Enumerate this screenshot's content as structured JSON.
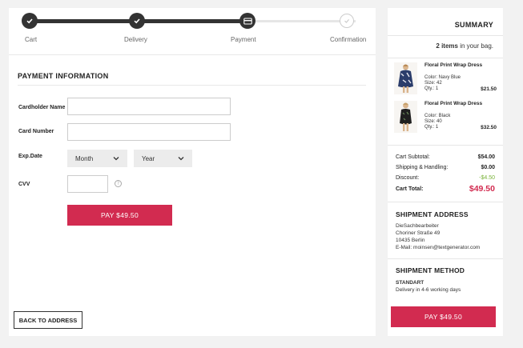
{
  "steps": [
    {
      "label": "Cart",
      "state": "done"
    },
    {
      "label": "Delivery",
      "state": "done"
    },
    {
      "label": "Payment",
      "state": "current"
    },
    {
      "label": "Confirmation",
      "state": "todo"
    }
  ],
  "payment": {
    "title": "PAYMENT INFORMATION",
    "cardholder_label": "Cardholder Name",
    "cardholder_value": "",
    "cardnumber_label": "Card Number",
    "cardnumber_value": "",
    "exp_label": "Exp.Date",
    "month_value": "Month",
    "year_value": "Year",
    "cvv_label": "CVV",
    "cvv_value": "",
    "help_symbol": "?",
    "pay_label": "PAY $49.50"
  },
  "back_label": "BACK TO ADDRESS",
  "summary": {
    "title": "SUMMARY",
    "items_count": "2 items",
    "items_suffix": " in your bag.",
    "products": [
      {
        "name": "Floral Print Wrap Dress",
        "color": "Color: Navy Blue",
        "size": "Size:  42",
        "qty": "Qty.:  1",
        "price": "$21.50"
      },
      {
        "name": "Floral Print Wrap Dress",
        "color": "Color: Black",
        "size": "Size:  40",
        "qty": "Qty.:  1",
        "price": "$32.50"
      }
    ],
    "subtotal_label": "Cart Subtotal:",
    "subtotal_value": "$54.00",
    "shipping_label": "Shipping & Handling:",
    "shipping_value": "$0.00",
    "discount_label": "Discount:",
    "discount_value": "-$4.50",
    "total_label": "Cart Total:",
    "total_value": "$49.50",
    "shipment_address_title": "SHIPMENT ADDRESS",
    "address_lines": [
      "DieSachbearbeiter",
      "Choriner Straße 49",
      "10435 Berlin",
      "E-Mail: moinsen@textgenerator.com"
    ],
    "shipment_method_title": "SHIPMENT METHOD",
    "method_name": "STANDART",
    "method_desc": "Delivery in 4-6 working days",
    "pay_label": "PAY $49.50"
  },
  "colors": {
    "accent": "#d22b50",
    "discount": "#7ab33a",
    "step_active": "#333333"
  }
}
